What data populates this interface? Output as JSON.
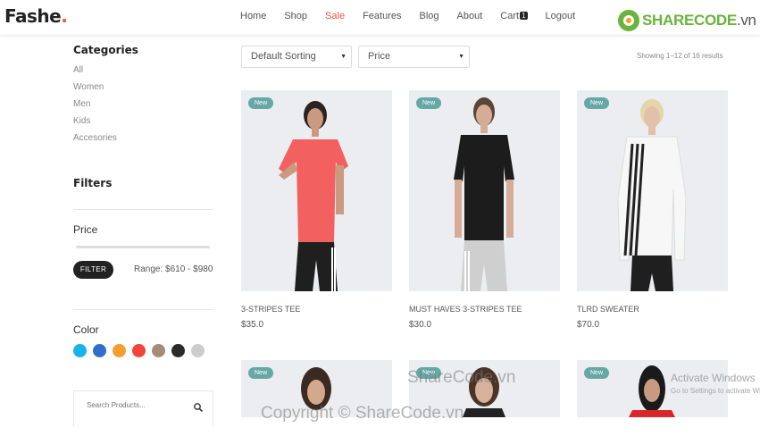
{
  "header": {
    "brand": "Fashe",
    "brand_dot": ".",
    "nav": [
      "Home",
      "Shop",
      "Sale",
      "Features",
      "Blog",
      "About",
      "Cart",
      "Logout"
    ],
    "cart_count": "1",
    "active": "Sale",
    "sharecode": "SHARECODE",
    "sharecode_tld": ".vn"
  },
  "sidebar": {
    "categories_title": "Categories",
    "categories": [
      "All",
      "Women",
      "Men",
      "Kids",
      "Accesories"
    ],
    "filters_title": "Filters",
    "price_label": "Price",
    "filter_button": "FILTER",
    "range_text": "Range: $610 - $980",
    "color_label": "Color",
    "colors": [
      "#1ab3e8",
      "#2f6fc9",
      "#f59d2e",
      "#f2433d",
      "#a38b78",
      "#2a2a2a",
      "#cccccc"
    ],
    "search_placeholder": "Search Products..."
  },
  "toolbar": {
    "sort": "Default Sorting",
    "price": "Price",
    "results": "Showing 1–12 of 16 results"
  },
  "products": [
    {
      "badge": "New",
      "name": "3-STRIPES TEE",
      "price": "$35.0"
    },
    {
      "badge": "New",
      "name": "MUST HAVES 3-STRIPES TEE",
      "price": "$30.0"
    },
    {
      "badge": "New",
      "name": "TLRD SWEATER",
      "price": "$70.0"
    },
    {
      "badge": "New"
    },
    {
      "badge": "New"
    },
    {
      "badge": "New"
    }
  ],
  "overlay": {
    "watermark_mid": "ShareCode.vn",
    "watermark_bottom": "Copyright © ShareCode.vn",
    "activate_title": "Activate Windows",
    "activate_sub": "Go to Settings to activate Windows."
  }
}
